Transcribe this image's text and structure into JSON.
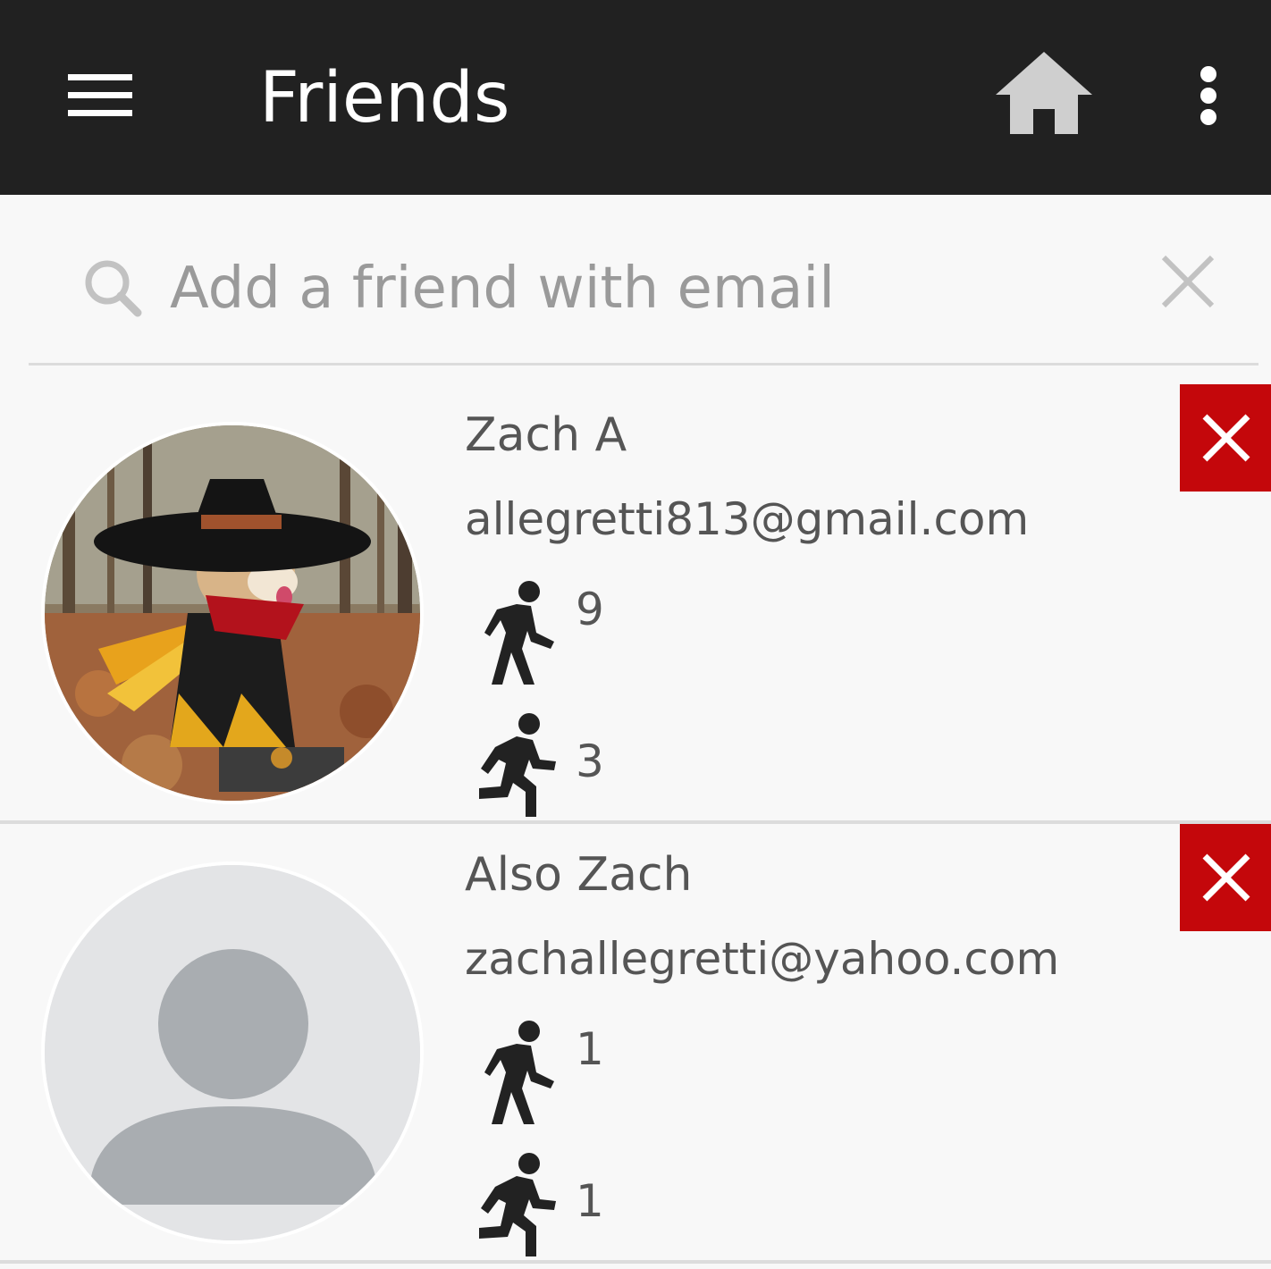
{
  "toolbar": {
    "title": "Friends",
    "menu_icon": "hamburger-menu-icon",
    "home_icon": "home-icon",
    "overflow_icon": "more-vert-icon",
    "background": "#212121",
    "home_icon_color": "#cfcfcf"
  },
  "search": {
    "placeholder": "Add a friend with email",
    "value": "",
    "search_icon": "search-icon",
    "clear_icon": "close-icon"
  },
  "friends": [
    {
      "name": "Zach A",
      "email": "allegretti813@gmail.com",
      "avatar": "photo of a shiba inu dog wearing a witch hat costume in autumn woods",
      "walk_icon": "walking-person-icon",
      "walk_count": "9",
      "run_icon": "running-person-icon",
      "run_count": "3",
      "remove_icon": "close-icon"
    },
    {
      "name": "Also Zach",
      "email": "zachallegretti@yahoo.com",
      "avatar": "default-person-avatar",
      "walk_icon": "walking-person-icon",
      "walk_count": "1",
      "run_icon": "running-person-icon",
      "run_count": "1",
      "remove_icon": "close-icon"
    }
  ],
  "colors": {
    "remove_button": "#c4070b",
    "text": "#555555",
    "placeholder": "#9a9a9a"
  }
}
